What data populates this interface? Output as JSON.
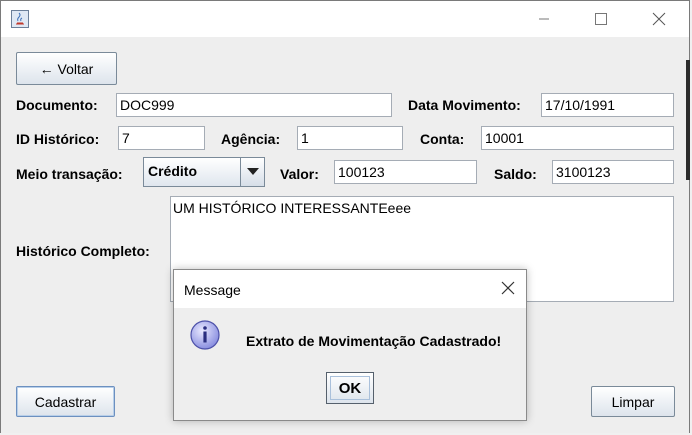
{
  "window": {
    "title": ""
  },
  "toolbar": {
    "back_label": "← Voltar"
  },
  "form": {
    "documento": {
      "label": "Documento:",
      "value": "DOC999"
    },
    "data_movimento": {
      "label": "Data Movimento:",
      "value": "17/10/1991"
    },
    "id_historico": {
      "label": "ID Histórico:",
      "value": "7"
    },
    "agencia": {
      "label": "Agência:",
      "value": "1"
    },
    "conta": {
      "label": "Conta:",
      "value": "10001"
    },
    "meio_transacao": {
      "label": "Meio transação:",
      "value": "Crédito"
    },
    "valor": {
      "label": "Valor:",
      "value": "100123"
    },
    "saldo": {
      "label": "Saldo:",
      "value": "3100123"
    },
    "historico": {
      "label": "Histórico Completo:",
      "value": "UM HISTÓRICO INTERESSANTEeee"
    }
  },
  "actions": {
    "cadastrar_label": "Cadastrar",
    "limpar_label": "Limpar"
  },
  "dialog": {
    "title": "Message",
    "message": "Extrato de Movimentação Cadastrado!",
    "ok_label": "OK",
    "icon": "info-icon"
  },
  "colors": {
    "accent": "#6c90c0",
    "info_icon": "#7a7fd0"
  }
}
